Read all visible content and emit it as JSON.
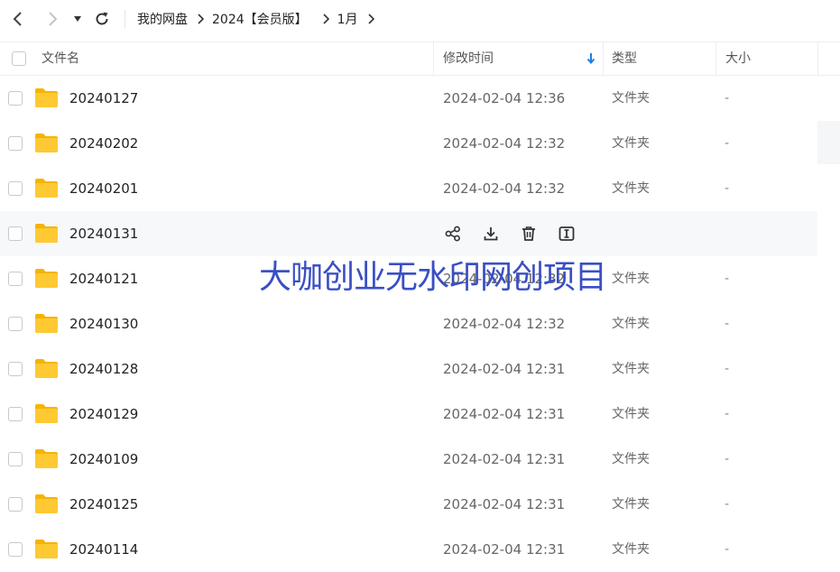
{
  "breadcrumb": [
    "我的网盘",
    "2024【会员版】",
    "1月"
  ],
  "columns": {
    "name": "文件名",
    "modified": "修改时间",
    "type": "类型",
    "size": "大小"
  },
  "rows": [
    {
      "name": "20240127",
      "modified": "2024-02-04 12:36",
      "type": "文件夹",
      "size": "-"
    },
    {
      "name": "20240202",
      "modified": "2024-02-04 12:32",
      "type": "文件夹",
      "size": "-"
    },
    {
      "name": "20240201",
      "modified": "2024-02-04 12:32",
      "type": "文件夹",
      "size": "-"
    },
    {
      "name": "20240131",
      "modified": "",
      "type": "",
      "size": "",
      "hover": true
    },
    {
      "name": "20240121",
      "modified": "2024-02-04 12:32",
      "type": "文件夹",
      "size": "-"
    },
    {
      "name": "20240130",
      "modified": "2024-02-04 12:32",
      "type": "文件夹",
      "size": "-"
    },
    {
      "name": "20240128",
      "modified": "2024-02-04 12:31",
      "type": "文件夹",
      "size": "-"
    },
    {
      "name": "20240129",
      "modified": "2024-02-04 12:31",
      "type": "文件夹",
      "size": "-"
    },
    {
      "name": "20240109",
      "modified": "2024-02-04 12:31",
      "type": "文件夹",
      "size": "-"
    },
    {
      "name": "20240125",
      "modified": "2024-02-04 12:31",
      "type": "文件夹",
      "size": "-"
    },
    {
      "name": "20240114",
      "modified": "2024-02-04 12:31",
      "type": "文件夹",
      "size": "-"
    }
  ],
  "row_actions": [
    "share-icon",
    "download-icon",
    "delete-icon",
    "rename-icon"
  ],
  "watermark": "大咖创业无水印网创项目",
  "colors": {
    "folder": "#ffc933",
    "folder_dark": "#f5b400",
    "sort_arrow": "#1e7fe6",
    "watermark": "#3a4fc4"
  }
}
